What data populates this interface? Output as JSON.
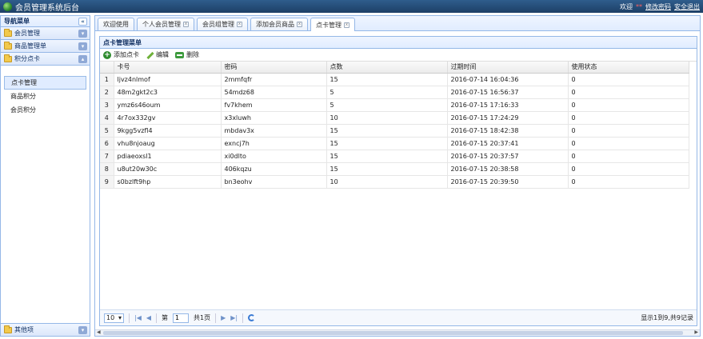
{
  "app": {
    "title": "会员管理系统后台",
    "welcome": "欢迎",
    "username": "**",
    "change_password": "修改密码",
    "logout": "安全退出"
  },
  "sidebar": {
    "title": "导航菜单",
    "collapse": "«",
    "sections": [
      {
        "label": "会员管理",
        "toggle": "▾"
      },
      {
        "label": "商品管理单",
        "toggle": "▾"
      },
      {
        "label": "积分点卡",
        "toggle": "▴"
      }
    ],
    "items": [
      {
        "label": "点卡管理"
      },
      {
        "label": "商品积分"
      },
      {
        "label": "会员积分"
      }
    ],
    "bottom_section": {
      "label": "其他项",
      "toggle": "▾"
    }
  },
  "tabs": [
    {
      "label": "欢迎使用",
      "closable": false
    },
    {
      "label": "个人会员管理",
      "closable": true
    },
    {
      "label": "会员组管理",
      "closable": true
    },
    {
      "label": "添加会员商品",
      "closable": true
    },
    {
      "label": "点卡管理",
      "closable": true
    }
  ],
  "panel": {
    "title": "点卡管理菜单",
    "toolbar": {
      "add": "添加点卡",
      "edit": "编辑",
      "delete": "删除"
    }
  },
  "table": {
    "columns": [
      "卡号",
      "密码",
      "点数",
      "过期时间",
      "使用状态"
    ],
    "rows": [
      [
        "1",
        "ljvz4nlmof",
        "2mmfqfr",
        "15",
        "2016-07-14 16:04:36",
        "0"
      ],
      [
        "2",
        "48m2gkt2c3",
        "54mdz68",
        "5",
        "2016-07-15 16:56:37",
        "0"
      ],
      [
        "3",
        "ymz6s46oum",
        "fv7khem",
        "5",
        "2016-07-15 17:16:33",
        "0"
      ],
      [
        "4",
        "4r7ox332gv",
        "x3xluwh",
        "10",
        "2016-07-15 17:24:29",
        "0"
      ],
      [
        "5",
        "9kgg5vzfl4",
        "mbdav3x",
        "15",
        "2016-07-15 18:42:38",
        "0"
      ],
      [
        "6",
        "vhu8njoaug",
        "exncj7h",
        "15",
        "2016-07-15 20:37:41",
        "0"
      ],
      [
        "7",
        "pdiaeoxsl1",
        "xi0dlto",
        "15",
        "2016-07-15 20:37:57",
        "0"
      ],
      [
        "8",
        "u8ut20w30c",
        "406kqzu",
        "15",
        "2016-07-15 20:38:58",
        "0"
      ],
      [
        "9",
        "s0bzlft9hp",
        "bn3eohv",
        "10",
        "2016-07-15 20:39:50",
        "0"
      ]
    ]
  },
  "pager": {
    "page_size": "10",
    "page_prefix": "第",
    "page_value": "1",
    "page_suffix": "共1页",
    "info": "显示1到9,共9记录"
  }
}
